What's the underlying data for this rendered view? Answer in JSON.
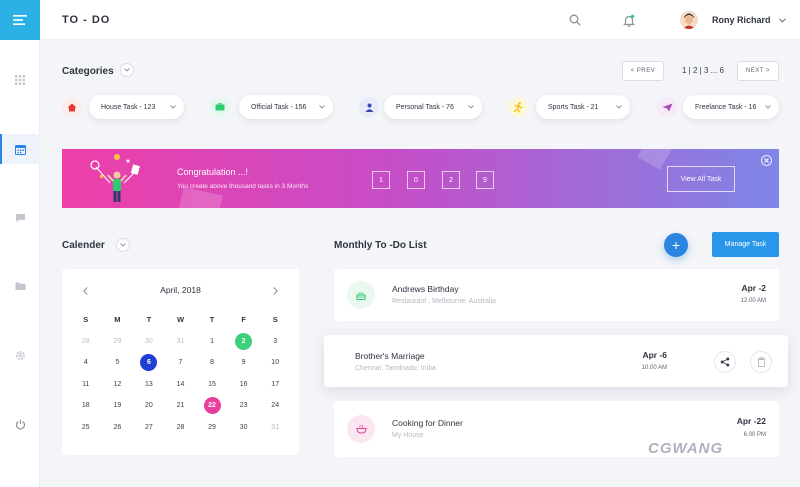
{
  "app": {
    "title": "TO - DO"
  },
  "user": {
    "name": "Rony Richard"
  },
  "categories": {
    "title": "Categories",
    "pager": {
      "prev": "< PREV",
      "pages": "1 | 2 | 3 ... 6",
      "next": "NEXT >"
    },
    "items": [
      {
        "label": "House Task - 123",
        "icon": "home-icon",
        "color": "#e53935"
      },
      {
        "label": "Official Task - 156",
        "icon": "briefcase-icon",
        "color": "#2ecc71"
      },
      {
        "label": "Personal Task - 76",
        "icon": "person-icon",
        "color": "#3949ab"
      },
      {
        "label": "Sports Task - 21",
        "icon": "running-icon",
        "color": "#f4c20d"
      },
      {
        "label": "Freelance Task - 16",
        "icon": "paper-plane-icon",
        "color": "#ab47bc"
      }
    ]
  },
  "banner": {
    "title": "Congratulation ...!",
    "subtitle": "You create above thousand tasks in 3 Months",
    "digits": [
      "1",
      "0",
      "2",
      "9"
    ],
    "button": "View All Task"
  },
  "calendar": {
    "title": "Calender",
    "month": "April, 2018",
    "weekdays": [
      "S",
      "M",
      "T",
      "W",
      "T",
      "F",
      "S"
    ],
    "days": [
      [
        "28",
        "29",
        "30",
        "31",
        "1",
        "2",
        "3"
      ],
      [
        "4",
        "5",
        "6",
        "7",
        "8",
        "9",
        "10"
      ],
      [
        "11",
        "12",
        "13",
        "14",
        "15",
        "16",
        "17"
      ],
      [
        "18",
        "19",
        "20",
        "21",
        "22",
        "23",
        "24"
      ],
      [
        "25",
        "26",
        "27",
        "28",
        "29",
        "30",
        "31"
      ]
    ],
    "highlight_colors": {
      "green": "#3ecf7a",
      "blue": "#1f3fd6",
      "pink": "#e83e9c"
    }
  },
  "todo": {
    "title": "Monthly To -Do List",
    "add_label": "+",
    "manage_label": "Manage Task",
    "tasks": [
      {
        "title": "Andrews Birthday",
        "subtitle": "Restaurant , Melbourne, Australia",
        "date": "Apr -2",
        "time": "12.00 AM"
      },
      {
        "title": "Brother's Marriage",
        "subtitle": "Chennai, Tamilnadu, India",
        "date": "Apr -6",
        "time": "10.00 AM"
      },
      {
        "title": "Cooking for Dinner",
        "subtitle": "My House",
        "date": "Apr -22",
        "time": "6.00 PM"
      }
    ]
  },
  "watermark": "CGWANG"
}
